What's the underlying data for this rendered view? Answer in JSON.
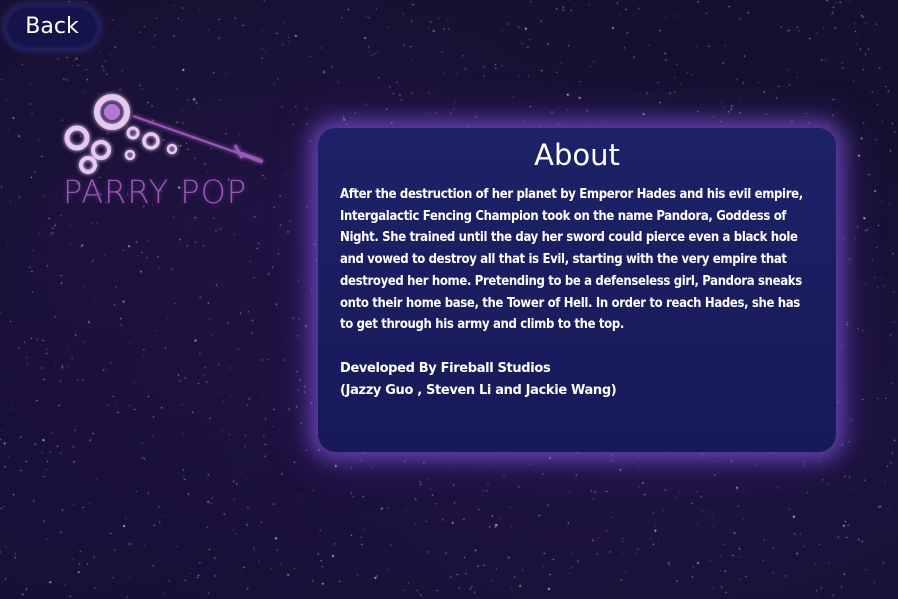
{
  "nav": {
    "back_label": "Back"
  },
  "logo": {
    "title": "PARRY POP",
    "icon": "bubbles-sword-icon",
    "color": "#9a57b8"
  },
  "about": {
    "title": "About",
    "body": "After the destruction of her planet by Emperor Hades and his evil empire, Intergalactic Fencing Champion took on the name Pandora, Goddess of Night. She trained until the day her sword could pierce even a black hole and vowed to destroy all that is Evil, starting with the very empire that destroyed her home. Pretending to be a defenseless girl, Pandora sneaks onto their home base, the Tower of Hell. In order to reach Hades, she has to get through his army and climb to the top.",
    "developer_line": "Developed By Fireball Studios",
    "team_line": "(Jazzy Guo , Steven Li and Jackie Wang)"
  },
  "colors": {
    "background": "#14102e",
    "panel": "#1d2268",
    "panel_glow": "#8c5ae6",
    "button": "#14144a"
  }
}
